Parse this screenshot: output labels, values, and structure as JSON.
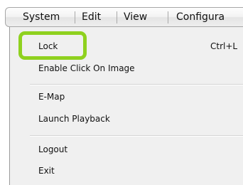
{
  "menubar": {
    "items": [
      "System",
      "Edit",
      "View",
      "Configura"
    ]
  },
  "menu": {
    "items": [
      {
        "label": "Lock",
        "shortcut": "Ctrl+L"
      },
      {
        "label": "Enable Click On Image"
      },
      {
        "label": "E-Map"
      },
      {
        "label": "Launch Playback"
      },
      {
        "label": "Logout"
      },
      {
        "label": "Exit"
      }
    ]
  },
  "colors": {
    "highlight": "#8fd11f",
    "menu_background": "#f0f0f0"
  }
}
